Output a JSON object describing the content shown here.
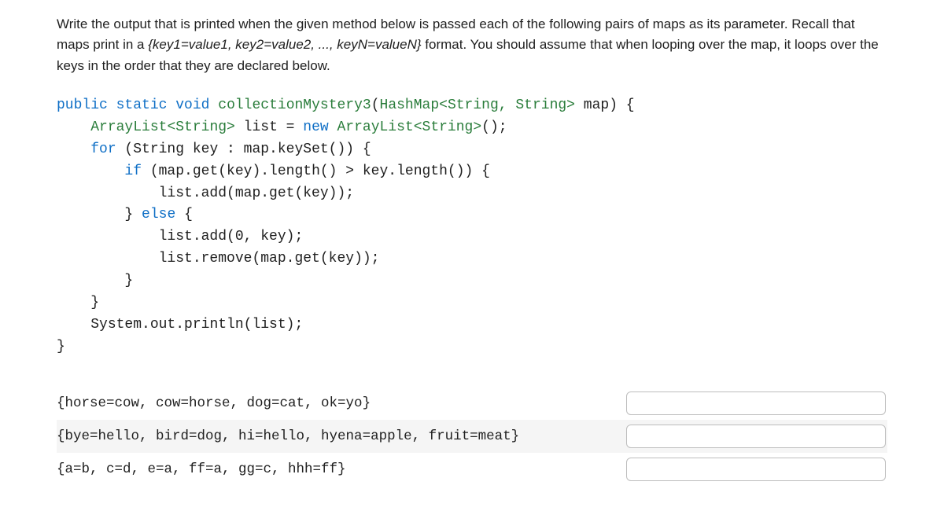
{
  "instructions": {
    "pre": "Write the output that is printed when the given method below is passed each of the following pairs of maps as its parameter. Recall that maps print in a ",
    "em": "{key1=value1, key2=value2, ..., keyN=valueN}",
    "post": " format. You should assume that when looping over the map, it loops over the keys in the order that they are declared below."
  },
  "code": {
    "kw_public": "public",
    "kw_static": "static",
    "kw_void": "void",
    "method": "collectionMystery3",
    "sig_open": "(",
    "hashmap": "HashMap",
    "str_gen": "<String, String>",
    "param": " map) {",
    "arraylist": "ArrayList",
    "str_gen2": "<String>",
    "decl": " list = ",
    "kw_new": "new",
    "ctor": "();",
    "kw_for": "for",
    "forhead": " (String key : map.keySet()) {",
    "kw_if": "if",
    "ifhead": " (map.get(key).length() > key.length()) {",
    "addval": "list.add(map.get(key));",
    "kw_else": "else",
    "elsehead": " {",
    "addkey": "list.add(0, key);",
    "removeval": "list.remove(map.get(key));",
    "rbrace": "}",
    "println": "System.out.println(list);"
  },
  "rows": [
    {
      "prompt": "{horse=cow, cow=horse, dog=cat, ok=yo}",
      "value": "",
      "placeholder": ""
    },
    {
      "prompt": "{bye=hello, bird=dog, hi=hello, hyena=apple, fruit=meat}",
      "value": "",
      "placeholder": ""
    },
    {
      "prompt": "{a=b, c=d, e=a, ff=a, gg=c, hhh=ff}",
      "value": "",
      "placeholder": ""
    }
  ]
}
